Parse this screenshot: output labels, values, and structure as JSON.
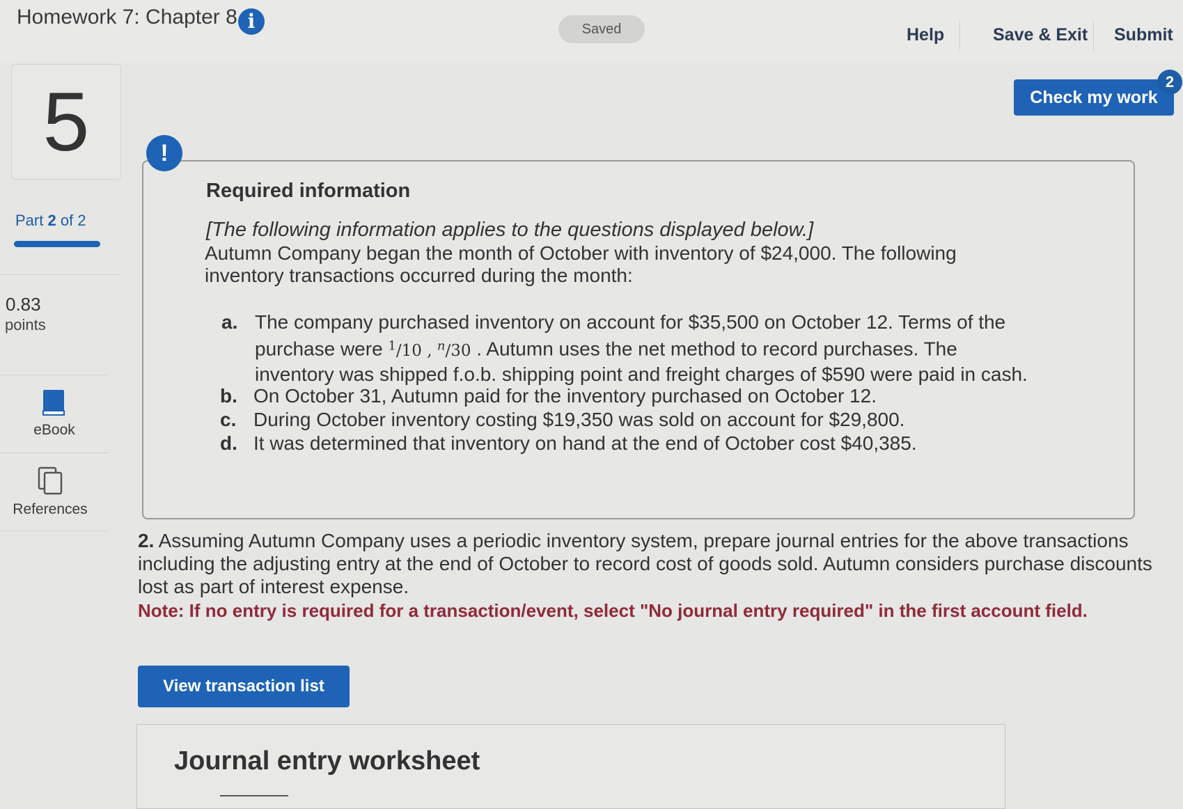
{
  "header": {
    "title": "Homework 7: Chapter 8",
    "saved": "Saved",
    "links": [
      "Help",
      "Save & Exit",
      "Submit"
    ]
  },
  "sidebar": {
    "question_number": "5",
    "part_word": "Part",
    "part_current": "2",
    "part_total": "of 2",
    "points_value": "0.83",
    "points_label": "points",
    "ebook": "eBook",
    "references": "References"
  },
  "check_my_work": {
    "label": "Check my work",
    "badge": "2"
  },
  "required": {
    "title": "Required information",
    "italic": "[The following information applies to the questions displayed below.]",
    "intro": "Autumn Company began the month of October with inventory of $24,000. The following inventory transactions occurred during the month:",
    "items": {
      "a": {
        "letter": "a.",
        "line1": "The company purchased inventory on account for $35,500 on October 12. Terms of the",
        "line2_pre": "purchase were",
        "terms1_num": "1",
        "terms1_den": "10",
        "terms_sep": ",",
        "terms2_num": "n",
        "terms2_den": "30",
        "line2_post": ". Autumn uses the net method to record purchases. The",
        "line3": "inventory was shipped f.o.b. shipping point and freight charges of $590 were paid in cash."
      },
      "b": {
        "letter": "b.",
        "text": "On October 31, Autumn paid for the inventory purchased on October 12."
      },
      "c": {
        "letter": "c.",
        "text": "During October inventory costing $19,350 was sold on account for $29,800."
      },
      "d": {
        "letter": "d.",
        "text": "It was determined that inventory on hand at the end of October cost $40,385."
      }
    }
  },
  "question": {
    "number": "2.",
    "text": "Assuming Autumn Company uses a periodic inventory system, prepare journal entries for the above transactions including the adjusting entry at the end of October to record cost of goods sold. Autumn considers purchase discounts lost as part of interest expense.",
    "note": "Note: If no entry is required for a transaction/event, select \"No journal entry required\" in the first account field."
  },
  "buttons": {
    "view_transactions": "View transaction list"
  },
  "worksheet": {
    "title": "Journal entry worksheet"
  },
  "colors": {
    "accent": "#1e63b5",
    "note": "#8f2b3a"
  },
  "icons": [
    "info-icon",
    "alert-icon",
    "book-icon",
    "references-icon"
  ]
}
